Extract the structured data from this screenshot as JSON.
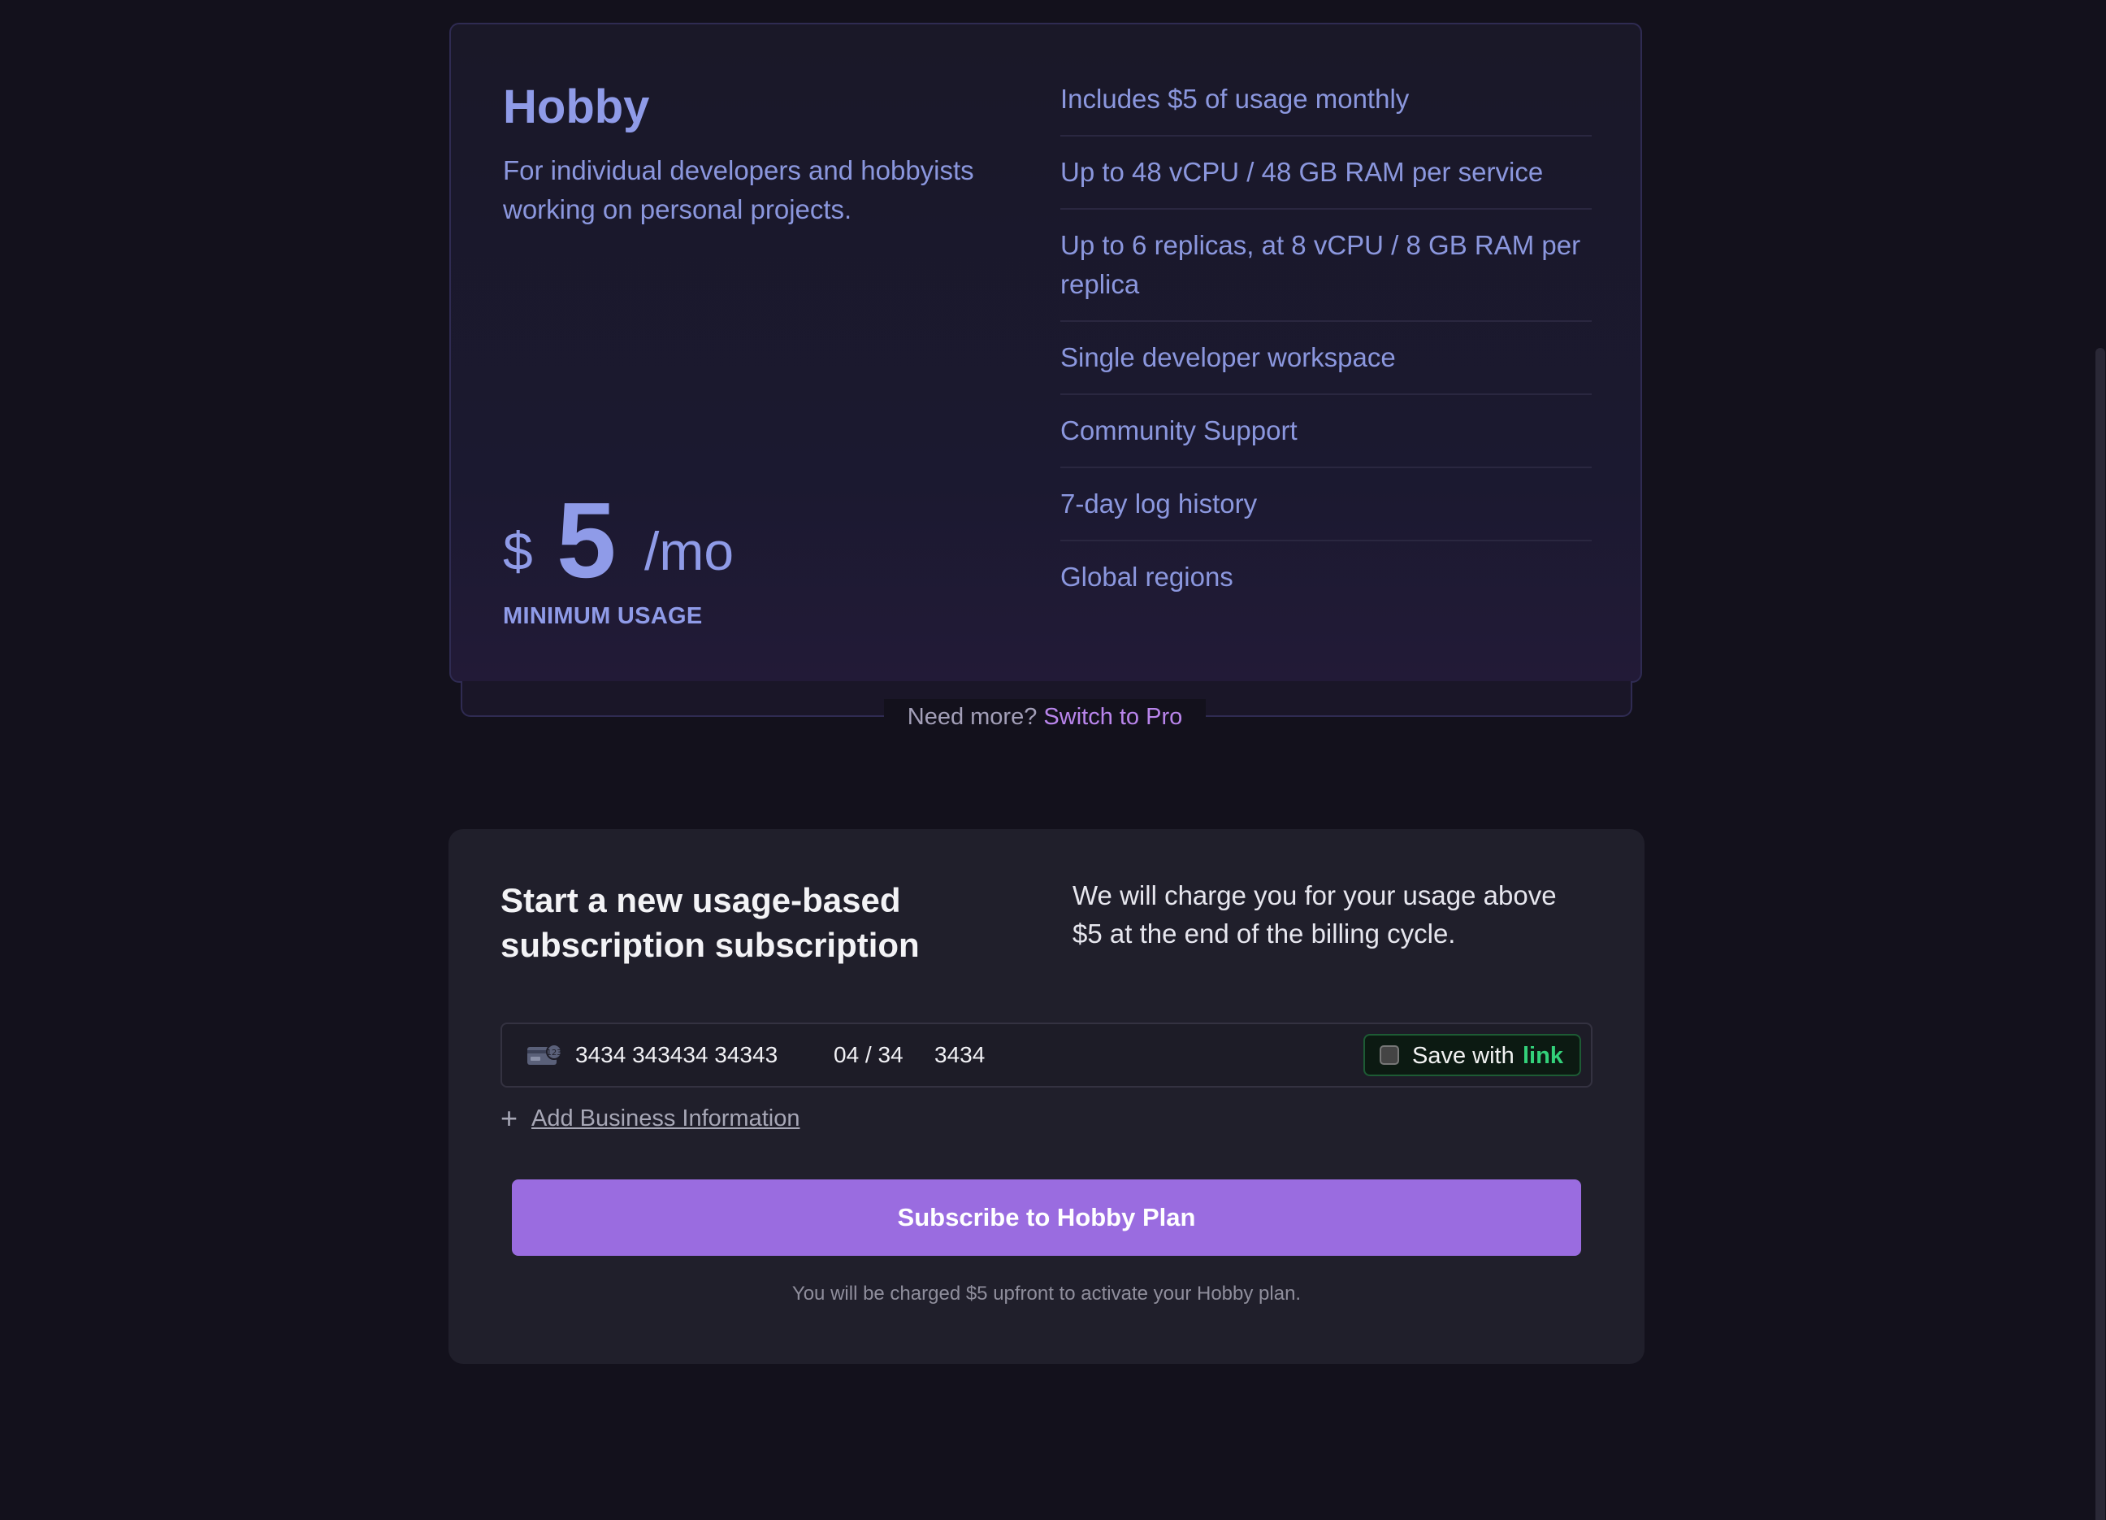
{
  "plan": {
    "name": "Hobby",
    "description": "For individual developers and hobbyists working on personal projects.",
    "price_currency": "$",
    "price_amount": "5",
    "price_period": "/mo",
    "price_note": "MINIMUM USAGE",
    "features": [
      "Includes $5 of usage monthly",
      "Up to 48 vCPU / 48 GB RAM per service",
      "Up to 6 replicas, at 8 vCPU / 8 GB RAM per replica",
      "Single developer workspace",
      "Community Support",
      "7-day log history",
      "Global regions"
    ]
  },
  "upsell": {
    "prefix": "Need more?",
    "link": "Switch to Pro"
  },
  "subscription": {
    "title": "Start a new usage-based subscription subscription",
    "note": "We will charge you for your usage above $5 at the end of the billing cycle.",
    "card": {
      "number": "3434 343434 34343",
      "expiry": "04 / 34",
      "cvc": "3434",
      "save_label": "Save with",
      "save_brand": "link"
    },
    "add_business": "Add Business Information",
    "button": "Subscribe to Hobby Plan",
    "charge_note": "You will be charged $5 upfront to activate your Hobby plan."
  },
  "colors": {
    "accent": "#9a6ce0",
    "plan_text": "#8f9be8",
    "link_green": "#33d17a"
  }
}
